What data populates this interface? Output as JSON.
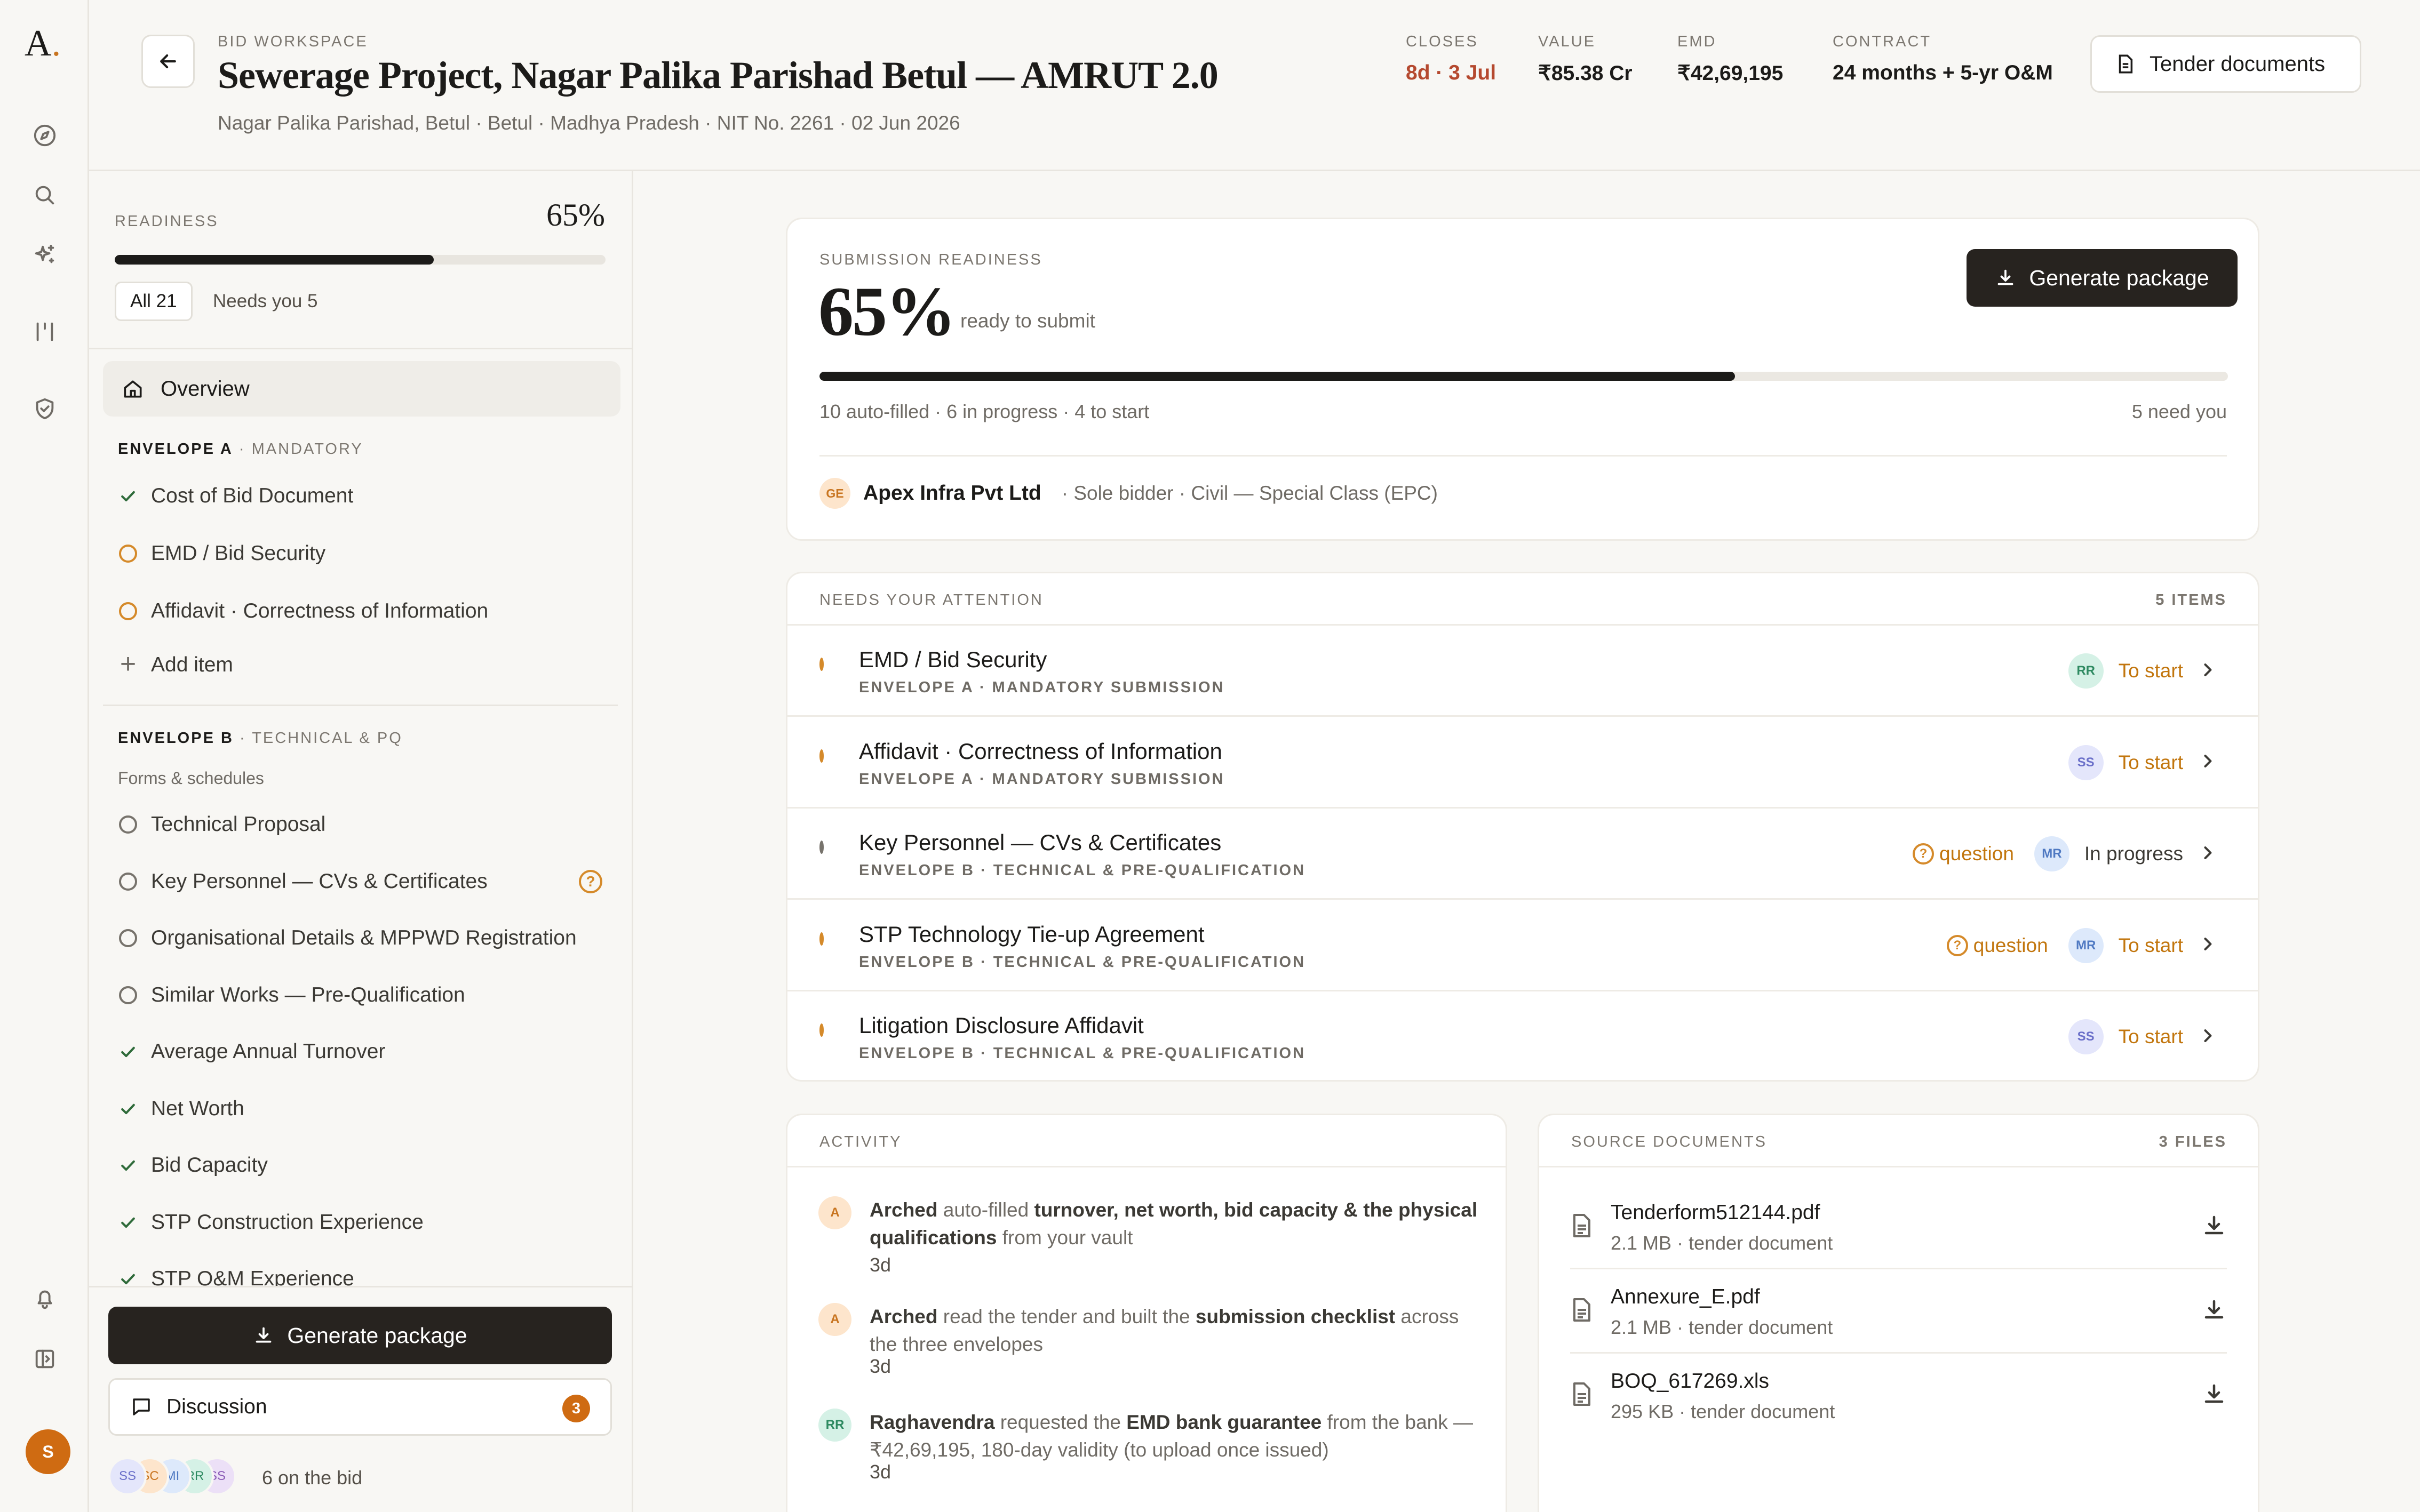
{
  "app": {
    "logo_letter": "A",
    "logo_dot": ".",
    "user_initial": "S"
  },
  "rail": {
    "icons": [
      "compass-icon",
      "search-icon",
      "sparkle-icon",
      "columns-icon",
      "shield-icon",
      "bell-icon",
      "sidebar-toggle-icon"
    ]
  },
  "header": {
    "eyebrow": "BID WORKSPACE",
    "title": "Sewerage Project, Nagar Palika Parishad Betul — AMRUT 2.0",
    "subtitle": "Nagar Palika Parishad, Betul · Betul · Madhya Pradesh · NIT No. 2261 · 02 Jun 2026",
    "closes_label": "CLOSES",
    "closes_value": "8d · 3 Jul",
    "value_label": "VALUE",
    "value_value": "₹85.38 Cr",
    "emd_label": "EMD",
    "emd_value": "₹42,69,195",
    "contract_label": "CONTRACT",
    "contract_value": "24 months + 5-yr O&M",
    "tender_button": "Tender documents"
  },
  "left": {
    "readiness_label": "READINESS",
    "readiness_pct": "65%",
    "readiness_fraction": 0.65,
    "filter_all": "All 21",
    "filter_needs": "Needs you 5",
    "overview": "Overview",
    "envA_title": "ENVELOPE A",
    "envA_sub": "· MANDATORY",
    "envA_items": [
      {
        "label": "Cost of Bid Document",
        "status": "done"
      },
      {
        "label": "EMD / Bid Security",
        "status": "todo"
      },
      {
        "label": "Affidavit · Correctness of Information",
        "status": "todo"
      }
    ],
    "add_item": "Add item",
    "envB_title": "ENVELOPE B",
    "envB_sub": "· TECHNICAL & PQ",
    "forms_label": "Forms & schedules",
    "envB_items": [
      {
        "label": "Technical Proposal",
        "status": "open"
      },
      {
        "label": "Key Personnel — CVs & Certificates",
        "status": "open"
      },
      {
        "label": "Organisational Details & MPPWD Registration",
        "status": "open"
      },
      {
        "label": "Similar Works — Pre-Qualification",
        "status": "open"
      },
      {
        "label": "Average Annual Turnover",
        "status": "done"
      },
      {
        "label": "Net Worth",
        "status": "done"
      },
      {
        "label": "Bid Capacity",
        "status": "done"
      },
      {
        "label": "STP Construction Experience",
        "status": "done"
      },
      {
        "label": "STP O&M Experience",
        "status": "done"
      }
    ],
    "generate": "Generate package",
    "discussion": "Discussion",
    "discussion_count": "3",
    "team": [
      "SS",
      "SC",
      "MI",
      "RR",
      "SS"
    ],
    "team_label": "6 on the bid"
  },
  "readiness_card": {
    "label": "SUBMISSION READINESS",
    "pct": "65%",
    "caption": "ready to submit",
    "fraction": 0.65,
    "generate": "Generate package",
    "stats": "10 auto-filled · 6 in progress · 4 to start",
    "need_you": "5 need you",
    "bidder_initials": "GE",
    "bidder_name": "Apex Infra Pvt Ltd",
    "bidder_meta": "· Sole bidder · Civil — Special Class (EPC)"
  },
  "attention": {
    "title": "NEEDS YOUR ATTENTION",
    "count": "5 ITEMS",
    "items": [
      {
        "title": "EMD / Bid Security",
        "sub": "ENVELOPE A · MANDATORY SUBMISSION",
        "question": "",
        "assignee": "RR",
        "status": "To start"
      },
      {
        "title": "Affidavit · Correctness of Information",
        "sub": "ENVELOPE A · MANDATORY SUBMISSION",
        "question": "",
        "assignee": "SS",
        "status": "To start"
      },
      {
        "title": "Key Personnel — CVs & Certificates",
        "sub": "ENVELOPE B · TECHNICAL & PRE-QUALIFICATION",
        "question": "question",
        "assignee": "MR",
        "status": "In progress"
      },
      {
        "title": "STP Technology Tie-up Agreement",
        "sub": "ENVELOPE B · TECHNICAL & PRE-QUALIFICATION",
        "question": "question",
        "assignee": "MR",
        "status": "To start"
      },
      {
        "title": "Litigation Disclosure Affidavit",
        "sub": "ENVELOPE B · TECHNICAL & PRE-QUALIFICATION",
        "question": "",
        "assignee": "SS",
        "status": "To start"
      }
    ]
  },
  "activity": {
    "title": "ACTIVITY",
    "items": [
      {
        "avatar": "A",
        "actor": "Arched",
        "t1": " auto-filled ",
        "b1": "turnover, net worth, bid capacity & the physical qualifications",
        "t2": " from your vault",
        "time": "3d"
      },
      {
        "avatar": "A",
        "actor": "Arched",
        "t1": " read the tender and built the ",
        "b1": "submission checklist",
        "t2": " across the three envelopes",
        "time": "3d"
      },
      {
        "avatar": "RR",
        "actor": "Raghavendra",
        "t1": " requested the ",
        "b1": "EMD bank guarantee",
        "t2": " from the bank — ₹42,69,195, 180-day validity (to upload once issued)",
        "time": "3d"
      }
    ]
  },
  "sources": {
    "title": "SOURCE DOCUMENTS",
    "count": "3 FILES",
    "files": [
      {
        "name": "Tenderform512144.pdf",
        "meta": "2.1 MB · tender document"
      },
      {
        "name": "Annexure_E.pdf",
        "meta": "2.1 MB · tender document"
      },
      {
        "name": "BOQ_617269.xls",
        "meta": "295 KB · tender document"
      }
    ]
  },
  "colors": {
    "accent": "#cf6b12",
    "dark_button": "#27231f",
    "closes_red": "#b5492f",
    "todo_orange": "#d58a2a",
    "done_green": "#2f6b3a"
  }
}
